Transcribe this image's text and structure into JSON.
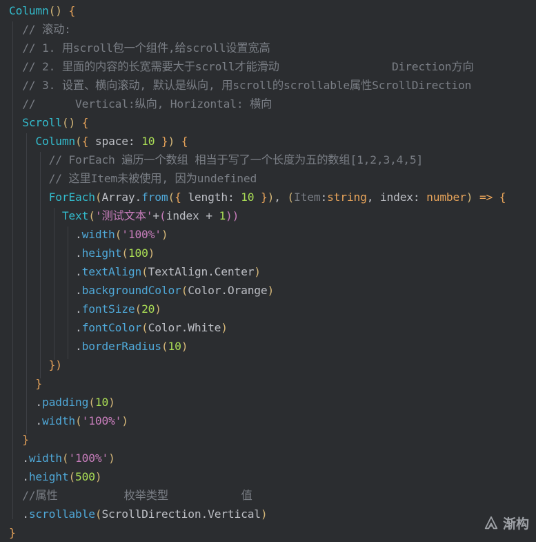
{
  "editor": {
    "lines": [
      [
        {
          "t": "Column",
          "c": "tk-comp"
        },
        {
          "t": "() ",
          "c": "tk-brace"
        },
        {
          "t": "{",
          "c": "tk-orange"
        }
      ],
      [
        {
          "t": "  // 滚动:",
          "c": "tk-comment"
        }
      ],
      [
        {
          "t": "  // 1. 用scroll包一个组件,给scroll设置宽高",
          "c": "tk-comment"
        }
      ],
      [
        {
          "t": "  // 2. 里面的内容的长宽需要大于scroll才能滑动                 Direction方向",
          "c": "tk-comment"
        }
      ],
      [
        {
          "t": "  // 3. 设置、横向滚动, 默认是纵向, 用scroll的scrollable属性ScrollDirection",
          "c": "tk-comment"
        }
      ],
      [
        {
          "t": "  //      Vertical:纵向, Horizontal: 横向",
          "c": "tk-comment"
        }
      ],
      [
        {
          "t": "  ",
          "c": "tk-default"
        },
        {
          "t": "Scroll",
          "c": "tk-comp"
        },
        {
          "t": "() ",
          "c": "tk-brace"
        },
        {
          "t": "{",
          "c": "tk-orange"
        }
      ],
      [
        {
          "t": "    ",
          "c": "tk-default"
        },
        {
          "t": "Column",
          "c": "tk-comp"
        },
        {
          "t": "(",
          "c": "tk-brace"
        },
        {
          "t": "{ ",
          "c": "tk-orange"
        },
        {
          "t": "space: ",
          "c": "tk-default"
        },
        {
          "t": "10",
          "c": "tk-num2"
        },
        {
          "t": " }",
          "c": "tk-orange"
        },
        {
          "t": ") ",
          "c": "tk-brace"
        },
        {
          "t": "{",
          "c": "tk-orange"
        }
      ],
      [
        {
          "t": "      // ForEach 遍历一个数组 相当于写了一个长度为五的数组[1,2,3,4,5]",
          "c": "tk-comment"
        }
      ],
      [
        {
          "t": "      // 这里Item未被使用, 因为undefined",
          "c": "tk-comment"
        }
      ],
      [
        {
          "t": "      ",
          "c": "tk-default"
        },
        {
          "t": "ForEach",
          "c": "tk-comp"
        },
        {
          "t": "(",
          "c": "tk-brace"
        },
        {
          "t": "Array.",
          "c": "tk-default"
        },
        {
          "t": "from",
          "c": "tk-prop2"
        },
        {
          "t": "(",
          "c": "tk-brace"
        },
        {
          "t": "{ ",
          "c": "tk-orange"
        },
        {
          "t": "length: ",
          "c": "tk-default"
        },
        {
          "t": "10",
          "c": "tk-num2"
        },
        {
          "t": " }",
          "c": "tk-orange"
        },
        {
          "t": ")",
          "c": "tk-brace"
        },
        {
          "t": ", ",
          "c": "tk-default"
        },
        {
          "t": "(",
          "c": "tk-brace"
        },
        {
          "t": "Item",
          "c": "tk-dim"
        },
        {
          "t": ":",
          "c": "tk-default"
        },
        {
          "t": "string",
          "c": "tk-orange"
        },
        {
          "t": ", index: ",
          "c": "tk-default"
        },
        {
          "t": "number",
          "c": "tk-orange"
        },
        {
          "t": ") ",
          "c": "tk-brace"
        },
        {
          "t": "=> ",
          "c": "tk-orange"
        },
        {
          "t": "{",
          "c": "tk-orange"
        }
      ],
      [
        {
          "t": "        ",
          "c": "tk-default"
        },
        {
          "t": "Text",
          "c": "tk-comp"
        },
        {
          "t": "(",
          "c": "tk-brace"
        },
        {
          "t": "'测试文本'",
          "c": "tk-str2"
        },
        {
          "t": "+",
          "c": "tk-default"
        },
        {
          "t": "(",
          "c": "tk-purple"
        },
        {
          "t": "index + ",
          "c": "tk-default"
        },
        {
          "t": "1",
          "c": "tk-num2"
        },
        {
          "t": "))",
          "c": "tk-purple"
        }
      ],
      [
        {
          "t": "          .",
          "c": "tk-default"
        },
        {
          "t": "width",
          "c": "tk-prop2"
        },
        {
          "t": "(",
          "c": "tk-brace"
        },
        {
          "t": "'100%'",
          "c": "tk-str2"
        },
        {
          "t": ")",
          "c": "tk-brace"
        }
      ],
      [
        {
          "t": "          .",
          "c": "tk-default"
        },
        {
          "t": "height",
          "c": "tk-prop2"
        },
        {
          "t": "(",
          "c": "tk-brace"
        },
        {
          "t": "100",
          "c": "tk-num2"
        },
        {
          "t": ")",
          "c": "tk-brace"
        }
      ],
      [
        {
          "t": "          .",
          "c": "tk-default"
        },
        {
          "t": "textAlign",
          "c": "tk-prop2"
        },
        {
          "t": "(",
          "c": "tk-brace"
        },
        {
          "t": "TextAlign.Center",
          "c": "tk-default"
        },
        {
          "t": ")",
          "c": "tk-brace"
        }
      ],
      [
        {
          "t": "          .",
          "c": "tk-default"
        },
        {
          "t": "backgroundColor",
          "c": "tk-prop2"
        },
        {
          "t": "(",
          "c": "tk-brace"
        },
        {
          "t": "Color.Orange",
          "c": "tk-default"
        },
        {
          "t": ")",
          "c": "tk-brace"
        }
      ],
      [
        {
          "t": "          .",
          "c": "tk-default"
        },
        {
          "t": "fontSize",
          "c": "tk-prop2"
        },
        {
          "t": "(",
          "c": "tk-brace"
        },
        {
          "t": "20",
          "c": "tk-num2"
        },
        {
          "t": ")",
          "c": "tk-brace"
        }
      ],
      [
        {
          "t": "          .",
          "c": "tk-default"
        },
        {
          "t": "fontColor",
          "c": "tk-prop2"
        },
        {
          "t": "(",
          "c": "tk-brace"
        },
        {
          "t": "Color.White",
          "c": "tk-default"
        },
        {
          "t": ")",
          "c": "tk-brace"
        }
      ],
      [
        {
          "t": "          .",
          "c": "tk-default"
        },
        {
          "t": "borderRadius",
          "c": "tk-prop2"
        },
        {
          "t": "(",
          "c": "tk-brace"
        },
        {
          "t": "10",
          "c": "tk-num2"
        },
        {
          "t": ")",
          "c": "tk-brace"
        }
      ],
      [
        {
          "t": "      ",
          "c": "tk-default"
        },
        {
          "t": "})",
          "c": "tk-orange"
        }
      ],
      [
        {
          "t": "    ",
          "c": "tk-default"
        },
        {
          "t": "}",
          "c": "tk-orange"
        }
      ],
      [
        {
          "t": "    .",
          "c": "tk-default"
        },
        {
          "t": "padding",
          "c": "tk-prop2"
        },
        {
          "t": "(",
          "c": "tk-brace"
        },
        {
          "t": "10",
          "c": "tk-num2"
        },
        {
          "t": ")",
          "c": "tk-brace"
        }
      ],
      [
        {
          "t": "    .",
          "c": "tk-default"
        },
        {
          "t": "width",
          "c": "tk-prop2"
        },
        {
          "t": "(",
          "c": "tk-brace"
        },
        {
          "t": "'100%'",
          "c": "tk-str2"
        },
        {
          "t": ")",
          "c": "tk-brace"
        }
      ],
      [
        {
          "t": "  ",
          "c": "tk-default"
        },
        {
          "t": "}",
          "c": "tk-orange"
        }
      ],
      [
        {
          "t": "  .",
          "c": "tk-default"
        },
        {
          "t": "width",
          "c": "tk-prop2"
        },
        {
          "t": "(",
          "c": "tk-brace"
        },
        {
          "t": "'100%'",
          "c": "tk-str2"
        },
        {
          "t": ")",
          "c": "tk-brace"
        }
      ],
      [
        {
          "t": "  .",
          "c": "tk-default"
        },
        {
          "t": "height",
          "c": "tk-prop2"
        },
        {
          "t": "(",
          "c": "tk-brace"
        },
        {
          "t": "500",
          "c": "tk-num2"
        },
        {
          "t": ")",
          "c": "tk-brace"
        }
      ],
      [
        {
          "t": "  //属性          枚举类型           值",
          "c": "tk-comment"
        }
      ],
      [
        {
          "t": "  .",
          "c": "tk-default"
        },
        {
          "t": "scrollable",
          "c": "tk-prop2"
        },
        {
          "t": "(",
          "c": "tk-brace"
        },
        {
          "t": "ScrollDirection.Vertical",
          "c": "tk-default"
        },
        {
          "t": ")",
          "c": "tk-brace"
        }
      ],
      [
        {
          "t": "}",
          "c": "tk-orange"
        }
      ]
    ]
  },
  "watermark": {
    "text": "渐构"
  }
}
